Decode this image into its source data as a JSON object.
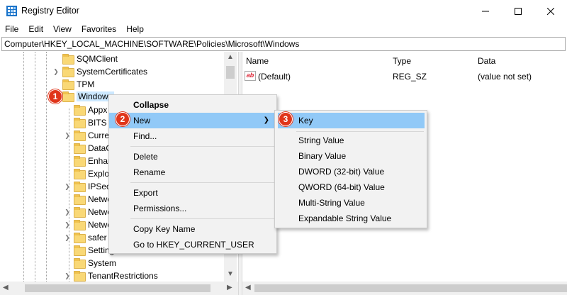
{
  "window": {
    "title": "Registry Editor",
    "app_icon": "registry-editor-icon"
  },
  "menubar": [
    "File",
    "Edit",
    "View",
    "Favorites",
    "Help"
  ],
  "address": "Computer\\HKEY_LOCAL_MACHINE\\SOFTWARE\\Policies\\Microsoft\\Windows",
  "tree": {
    "items": [
      {
        "label": "SQMClient",
        "expandable": false
      },
      {
        "label": "SystemCertificates",
        "expandable": true
      },
      {
        "label": "TPM",
        "expandable": false
      },
      {
        "label": "Windows",
        "expandable": true,
        "expanded": true,
        "selected": true
      },
      {
        "label": "Appx",
        "expandable": false
      },
      {
        "label": "BITS",
        "expandable": false
      },
      {
        "label": "Curre",
        "expandable": true
      },
      {
        "label": "DataC",
        "expandable": false
      },
      {
        "label": "Enhar",
        "expandable": false
      },
      {
        "label": "Explo",
        "expandable": false
      },
      {
        "label": "IPSec",
        "expandable": true
      },
      {
        "label": "Netwo",
        "expandable": false
      },
      {
        "label": "Netwo",
        "expandable": true
      },
      {
        "label": "Netwo",
        "expandable": true
      },
      {
        "label": "safer",
        "expandable": true
      },
      {
        "label": "Setting",
        "expandable": false
      },
      {
        "label": "System",
        "expandable": false
      },
      {
        "label": "TenantRestrictions",
        "expandable": true
      }
    ]
  },
  "list": {
    "columns": [
      "Name",
      "Type",
      "Data"
    ],
    "rows": [
      {
        "name": "(Default)",
        "type": "REG_SZ",
        "data": "(value not set)",
        "icon": "string-value-icon"
      }
    ]
  },
  "context_menu": {
    "items": [
      {
        "label": "Collapse",
        "bold": true
      },
      {
        "label": "New",
        "submenu": true,
        "highlight": true
      },
      {
        "label": "Find..."
      },
      {
        "separator": true
      },
      {
        "label": "Delete"
      },
      {
        "label": "Rename"
      },
      {
        "separator": true
      },
      {
        "label": "Export"
      },
      {
        "label": "Permissions..."
      },
      {
        "separator": true
      },
      {
        "label": "Copy Key Name"
      },
      {
        "label": "Go to HKEY_CURRENT_USER"
      }
    ]
  },
  "sub_menu": {
    "items": [
      {
        "label": "Key",
        "highlight": true
      },
      {
        "separator": true
      },
      {
        "label": "String Value"
      },
      {
        "label": "Binary Value"
      },
      {
        "label": "DWORD (32-bit) Value"
      },
      {
        "label": "QWORD (64-bit) Value"
      },
      {
        "label": "Multi-String Value"
      },
      {
        "label": "Expandable String Value"
      }
    ]
  },
  "badges": [
    "1",
    "2",
    "3"
  ],
  "colors": {
    "badge": "#e0351a",
    "highlight": "#91c9f7",
    "selection": "#cce8ff",
    "folder": "#f9d876"
  }
}
